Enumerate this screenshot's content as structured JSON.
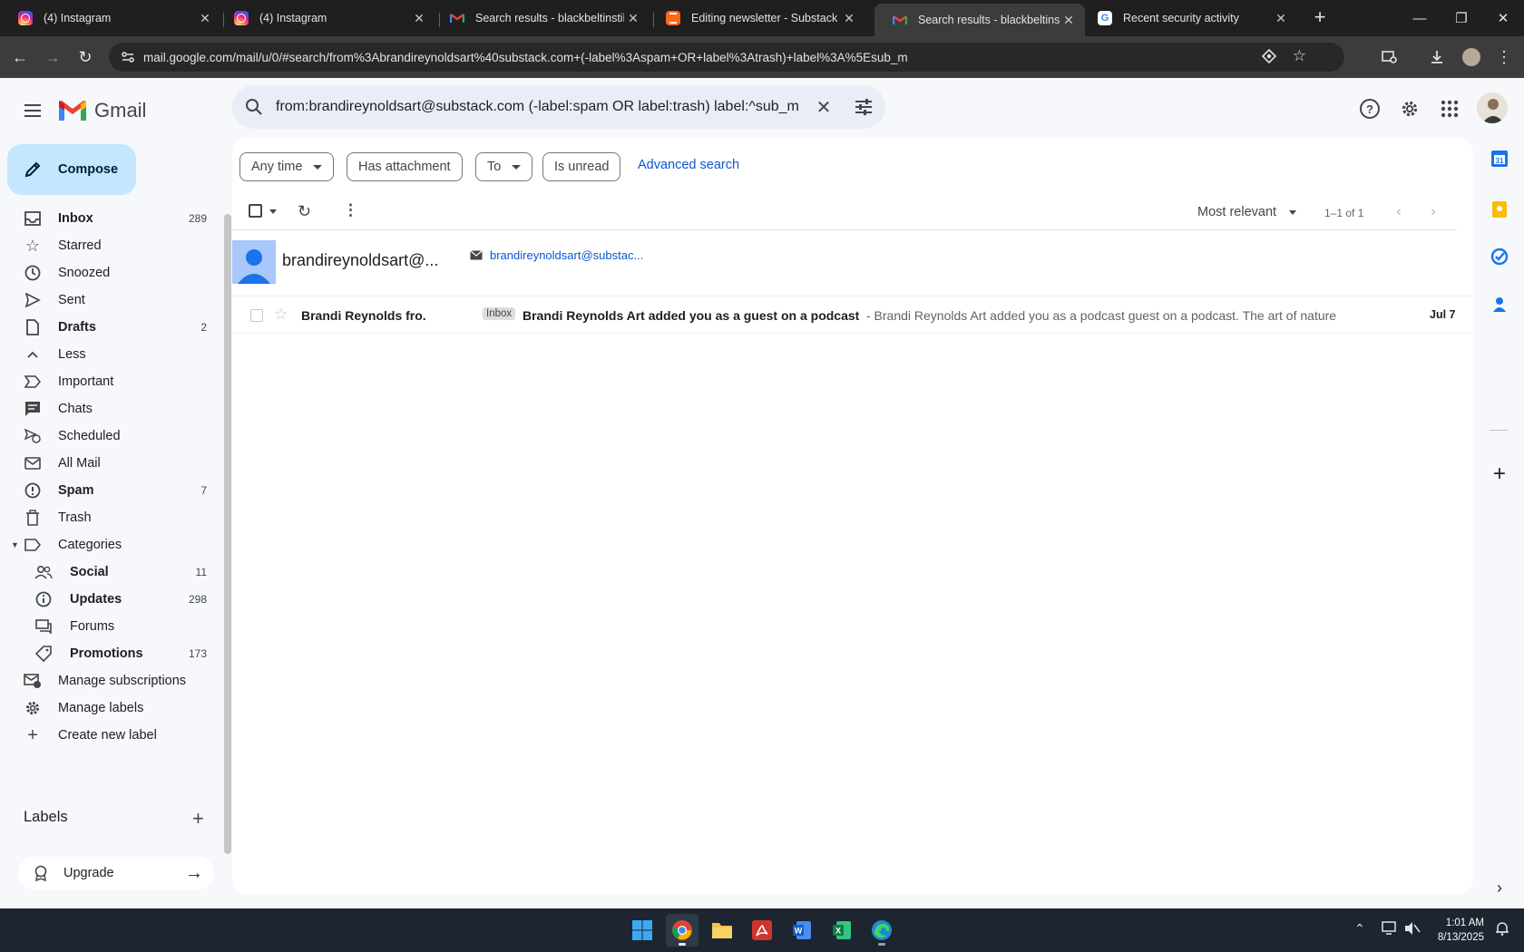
{
  "browser": {
    "tabs": [
      {
        "title": "(4) Instagram",
        "favicon": "instagram-icon"
      },
      {
        "title": "(4) Instagram",
        "favicon": "instagram-icon"
      },
      {
        "title": "Search results - blackbeltinstile",
        "favicon": "gmail-icon"
      },
      {
        "title": "Editing newsletter - Substack",
        "favicon": "substack-icon"
      },
      {
        "title": "Search results - blackbeltinstile",
        "favicon": "gmail-icon"
      },
      {
        "title": "Recent security activity",
        "favicon": "google-icon"
      }
    ],
    "active_tab": 4,
    "url": "mail.google.com/mail/u/0/#search/from%3Abrandireynoldsart%40substack.com+(-label%3Aspam+OR+label%3Atrash)+label%3A%5Esub_m"
  },
  "gmail": {
    "logo_text": "Gmail",
    "search_query": "from:brandireynoldsart@substack.com (-label:spam OR label:trash) label:^sub_m",
    "compose_label": "Compose",
    "nav": [
      {
        "name": "Inbox",
        "count": "289",
        "bold": true,
        "icon": "inbox-icon"
      },
      {
        "name": "Starred",
        "count": "",
        "bold": false,
        "icon": "star-icon"
      },
      {
        "name": "Snoozed",
        "count": "",
        "bold": false,
        "icon": "clock-icon"
      },
      {
        "name": "Sent",
        "count": "",
        "bold": false,
        "icon": "send-icon"
      },
      {
        "name": "Drafts",
        "count": "2",
        "bold": true,
        "icon": "draft-icon"
      },
      {
        "name": "Less",
        "count": "",
        "bold": false,
        "icon": "chevron-up-icon"
      },
      {
        "name": "Important",
        "count": "",
        "bold": false,
        "icon": "important-icon"
      },
      {
        "name": "Chats",
        "count": "",
        "bold": false,
        "icon": "chat-icon"
      },
      {
        "name": "Scheduled",
        "count": "",
        "bold": false,
        "icon": "scheduled-icon"
      },
      {
        "name": "All Mail",
        "count": "",
        "bold": false,
        "icon": "all-mail-icon"
      },
      {
        "name": "Spam",
        "count": "7",
        "bold": true,
        "icon": "spam-icon"
      },
      {
        "name": "Trash",
        "count": "",
        "bold": false,
        "icon": "trash-icon"
      },
      {
        "name": "Categories",
        "count": "",
        "bold": false,
        "icon": "label-icon"
      }
    ],
    "categories": [
      {
        "name": "Social",
        "count": "11",
        "bold": true,
        "icon": "people-icon"
      },
      {
        "name": "Updates",
        "count": "298",
        "bold": true,
        "icon": "info-icon"
      },
      {
        "name": "Forums",
        "count": "",
        "bold": false,
        "icon": "forum-icon"
      },
      {
        "name": "Promotions",
        "count": "173",
        "bold": true,
        "icon": "tag-icon"
      }
    ],
    "more_nav": [
      {
        "name": "Manage subscriptions",
        "icon": "manage-subscriptions-icon"
      },
      {
        "name": "Manage labels",
        "icon": "gear-icon"
      },
      {
        "name": "Create new label",
        "icon": "plus-icon"
      }
    ],
    "labels_heading": "Labels",
    "upgrade_label": "Upgrade",
    "filters": {
      "any_time": "Any time",
      "has_attachment": "Has attachment",
      "to": "To",
      "is_unread": "Is unread",
      "advanced": "Advanced search"
    },
    "sort_label": "Most relevant",
    "pagination": "1–1 of 1",
    "contact": {
      "name": "brandireynoldsart@...",
      "email": "brandireynoldsart@substac..."
    },
    "messages": [
      {
        "from": "Brandi Reynolds fro.",
        "label": "Inbox",
        "subject": "Brandi Reynolds Art added you as a guest on a podcast",
        "snippet": " - Brandi Reynolds Art added you as a podcast guest on a podcast. The art of nature a ...",
        "date": "Jul 7"
      }
    ]
  },
  "taskbar": {
    "time": "1:01 AM",
    "date": "8/13/2025"
  }
}
